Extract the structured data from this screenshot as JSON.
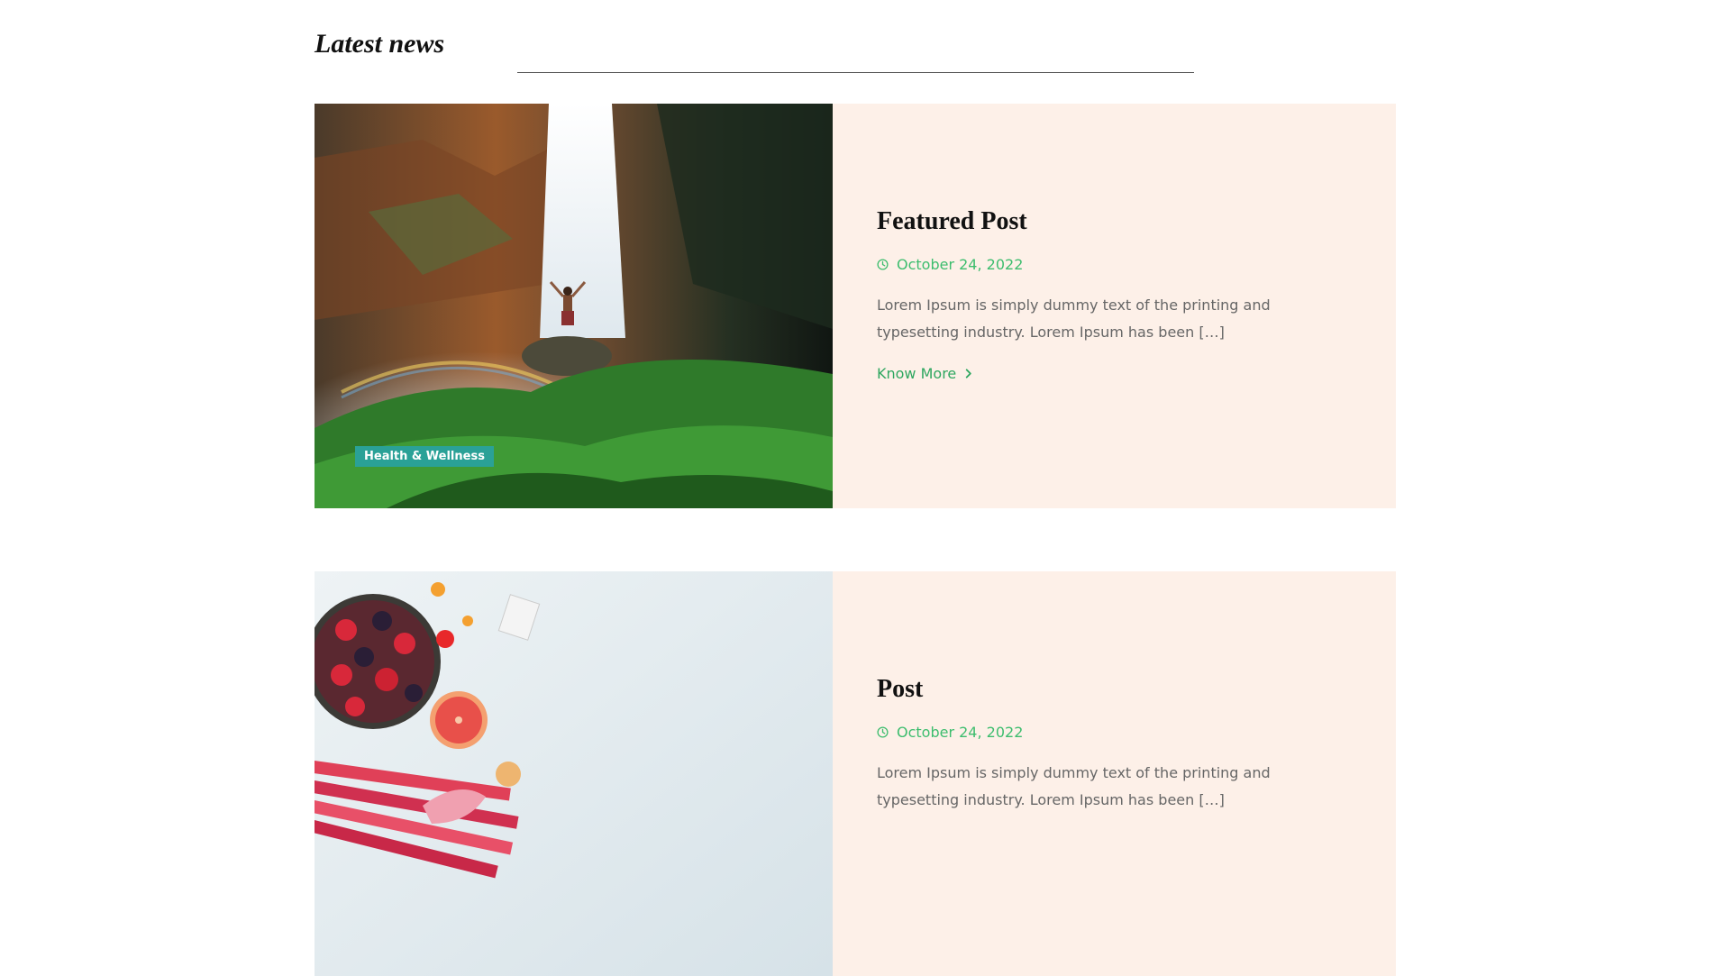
{
  "section": {
    "title": "Latest news"
  },
  "posts": [
    {
      "title": "Featured Post",
      "date": "October 24, 2022",
      "excerpt": "Lorem Ipsum is simply dummy text of the printing and typesetting industry. Lorem Ipsum has been […]",
      "more_label": "Know More",
      "category": "Health & Wellness",
      "image": "waterfall-photo"
    },
    {
      "title": "Post",
      "date": "October 24, 2022",
      "excerpt": "Lorem Ipsum is simply dummy text of the printing and typesetting industry. Lorem Ipsum has been […]",
      "image": "fruit-flatlay-photo"
    }
  ],
  "icons": {
    "date": "clock-icon",
    "more": "chevron-right-icon"
  },
  "colors": {
    "accent_green": "#3dbd6e",
    "link_green": "#2fa760",
    "card_bg": "#fdf0e8",
    "badge_teal": "#2aa197",
    "body_text": "#666666"
  }
}
